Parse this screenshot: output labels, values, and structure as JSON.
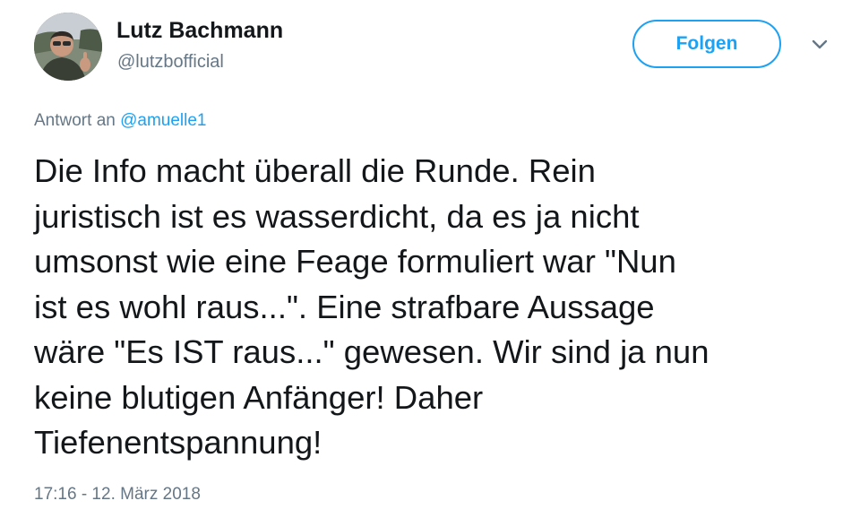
{
  "user": {
    "display_name": "Lutz Bachmann",
    "handle": "@lutzbofficial"
  },
  "header": {
    "follow_label": "Folgen",
    "caret_icon": "chevron-down-icon"
  },
  "reply": {
    "prefix": "Antwort an",
    "mention": "@amuelle1"
  },
  "tweet": {
    "lines": [
      "Die Info macht überall die Runde. Rein",
      "juristisch ist es wasserdicht, da es ja nicht",
      "umsonst wie eine Feage formuliert war \"Nun",
      "ist es wohl raus...\". Eine strafbare Aussage",
      "wäre \"Es IST raus...\" gewesen. Wir sind ja nun",
      "keine blutigen Anfänger! Daher",
      "Tiefenentspannung!"
    ],
    "timestamp": "17:16 - 12. März 2018"
  },
  "colors": {
    "accent": "#1da1f2",
    "text": "#14171a",
    "muted": "#657786"
  }
}
